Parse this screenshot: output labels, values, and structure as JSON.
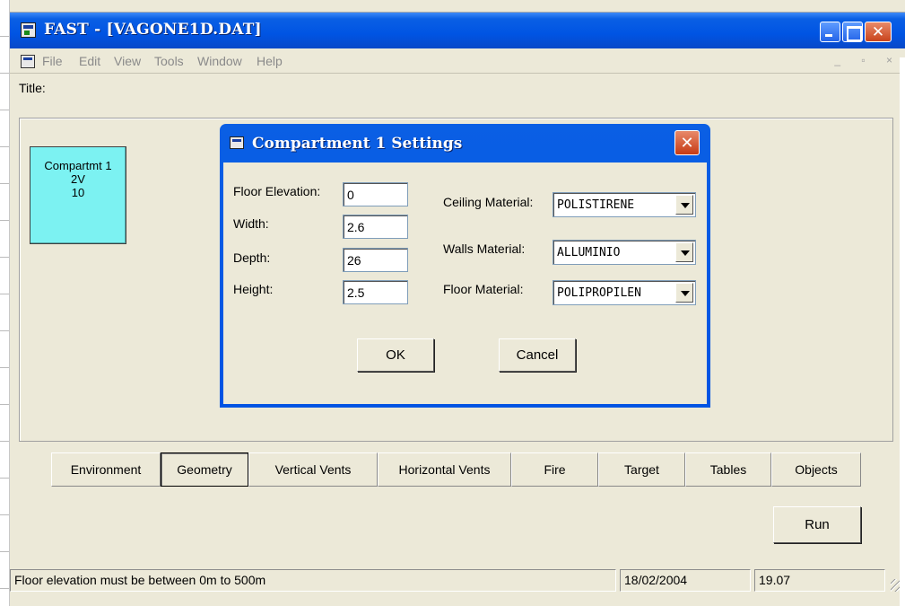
{
  "window": {
    "title": "FAST - [VAGONE1D.DAT]"
  },
  "menu": {
    "items": [
      "File",
      "Edit",
      "View",
      "Tools",
      "Window",
      "Help"
    ],
    "mdi_buttons": "_ ▫ ×"
  },
  "form": {
    "title_label": "Title:"
  },
  "compartment": {
    "name": "Compartmt 1",
    "line2": "2V",
    "line3": "10",
    "color": "#7cf2f2"
  },
  "tabs": [
    "Environment",
    "Geometry",
    "Vertical Vents",
    "Horizontal Vents",
    "Fire",
    "Target",
    "Tables",
    "Objects"
  ],
  "active_tab": "Geometry",
  "run_button": "Run",
  "status": {
    "message": "Floor elevation must be between 0m to 500m",
    "date": "18/02/2004",
    "time": "19.07"
  },
  "dialog": {
    "title": "Compartment 1 Settings",
    "fields": {
      "floor_elevation": {
        "label": "Floor Elevation:",
        "value": "0"
      },
      "width": {
        "label": "Width:",
        "value": "2.6"
      },
      "depth": {
        "label": "Depth:",
        "value": "26"
      },
      "height": {
        "label": "Height:",
        "value": "2.5"
      }
    },
    "materials": {
      "ceiling": {
        "label": "Ceiling Material:",
        "value": "POLISTIRENE"
      },
      "walls": {
        "label": "Walls Material:",
        "value": "ALLUMINIO"
      },
      "floor": {
        "label": "Floor Material:",
        "value": "POLIPROPILEN"
      }
    },
    "ok_label": "OK",
    "cancel_label": "Cancel"
  },
  "colors": {
    "titlebar": "#0054e3",
    "close_button": "#c63a14",
    "face": "#ece9d8"
  }
}
